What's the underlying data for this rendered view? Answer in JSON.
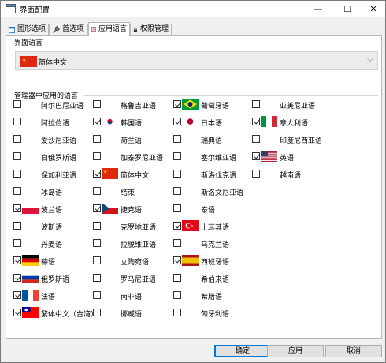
{
  "window": {
    "title": "界面配置",
    "minimize": "—",
    "maximize": "☐",
    "close": "✕"
  },
  "tabs": [
    {
      "label": "图形选项",
      "icon": "window-icon",
      "active": false
    },
    {
      "label": "首选项",
      "icon": "wrench-icon",
      "active": false
    },
    {
      "label": "应用语言",
      "icon": "language-icon",
      "active": true
    },
    {
      "label": "权限管理",
      "icon": "lock-icon",
      "active": false
    }
  ],
  "interface_language": {
    "section_title": "界面语言",
    "selected": "简体中文",
    "flag": "cn"
  },
  "manager_languages": {
    "section_title": "管理器中应用的语言",
    "columns": [
      [
        {
          "label": "阿尔巴尼亚语",
          "checked": false,
          "flag": ""
        },
        {
          "label": "阿拉伯语",
          "checked": false,
          "flag": ""
        },
        {
          "label": "爱沙尼亚语",
          "checked": false,
          "flag": ""
        },
        {
          "label": "白俄罗斯语",
          "checked": false,
          "flag": ""
        },
        {
          "label": "保加利亚语",
          "checked": false,
          "flag": ""
        },
        {
          "label": "冰岛语",
          "checked": false,
          "flag": ""
        },
        {
          "label": "波兰语",
          "checked": true,
          "flag": "pl"
        },
        {
          "label": "波斯语",
          "checked": false,
          "flag": ""
        },
        {
          "label": "丹麦语",
          "checked": false,
          "flag": ""
        },
        {
          "label": "德语",
          "checked": true,
          "flag": "de"
        },
        {
          "label": "俄罗斯语",
          "checked": true,
          "flag": "ru"
        },
        {
          "label": "法语",
          "checked": true,
          "flag": "fr"
        },
        {
          "label": "繁体中文（台湾）",
          "checked": true,
          "flag": "tw"
        }
      ],
      [
        {
          "label": "格鲁吉亚语",
          "checked": false,
          "flag": ""
        },
        {
          "label": "韩国语",
          "checked": true,
          "flag": "kr"
        },
        {
          "label": "荷兰语",
          "checked": false,
          "flag": ""
        },
        {
          "label": "加泰罗尼亚语",
          "checked": false,
          "flag": ""
        },
        {
          "label": "简体中文",
          "checked": true,
          "flag": "cn"
        },
        {
          "label": "结束",
          "checked": false,
          "flag": ""
        },
        {
          "label": "捷克语",
          "checked": true,
          "flag": "cz"
        },
        {
          "label": "克罗地亚语",
          "checked": false,
          "flag": ""
        },
        {
          "label": "拉脱维亚语",
          "checked": false,
          "flag": ""
        },
        {
          "label": "立陶宛语",
          "checked": false,
          "flag": ""
        },
        {
          "label": "罗马尼亚语",
          "checked": false,
          "flag": ""
        },
        {
          "label": "南非语",
          "checked": false,
          "flag": ""
        },
        {
          "label": "挪威语",
          "checked": false,
          "flag": ""
        }
      ],
      [
        {
          "label": "葡萄牙语",
          "checked": true,
          "flag": "br"
        },
        {
          "label": "日本语",
          "checked": true,
          "flag": "jp"
        },
        {
          "label": "瑞典语",
          "checked": false,
          "flag": ""
        },
        {
          "label": "塞尔维亚语",
          "checked": false,
          "flag": ""
        },
        {
          "label": "斯洛伐克语",
          "checked": false,
          "flag": ""
        },
        {
          "label": "斯洛文尼亚语",
          "checked": false,
          "flag": ""
        },
        {
          "label": "泰语",
          "checked": false,
          "flag": ""
        },
        {
          "label": "土耳其语",
          "checked": true,
          "flag": "tr"
        },
        {
          "label": "乌克兰语",
          "checked": false,
          "flag": ""
        },
        {
          "label": "西班牙语",
          "checked": true,
          "flag": "es"
        },
        {
          "label": "希伯来语",
          "checked": false,
          "flag": ""
        },
        {
          "label": "希腊语",
          "checked": false,
          "flag": ""
        },
        {
          "label": "匈牙利语",
          "checked": false,
          "flag": ""
        }
      ],
      [
        {
          "label": "亚美尼亚语",
          "checked": false,
          "flag": ""
        },
        {
          "label": "意大利语",
          "checked": true,
          "flag": "it"
        },
        {
          "label": "印度尼西亚语",
          "checked": false,
          "flag": ""
        },
        {
          "label": "英语",
          "checked": true,
          "flag": "us"
        },
        {
          "label": "越南语",
          "checked": false,
          "flag": ""
        }
      ]
    ]
  },
  "buttons": {
    "ok": "确定",
    "apply": "应用",
    "cancel": "取消"
  },
  "colors": {
    "accent": "#0078d7",
    "window_bg": "#f0f0f0"
  }
}
